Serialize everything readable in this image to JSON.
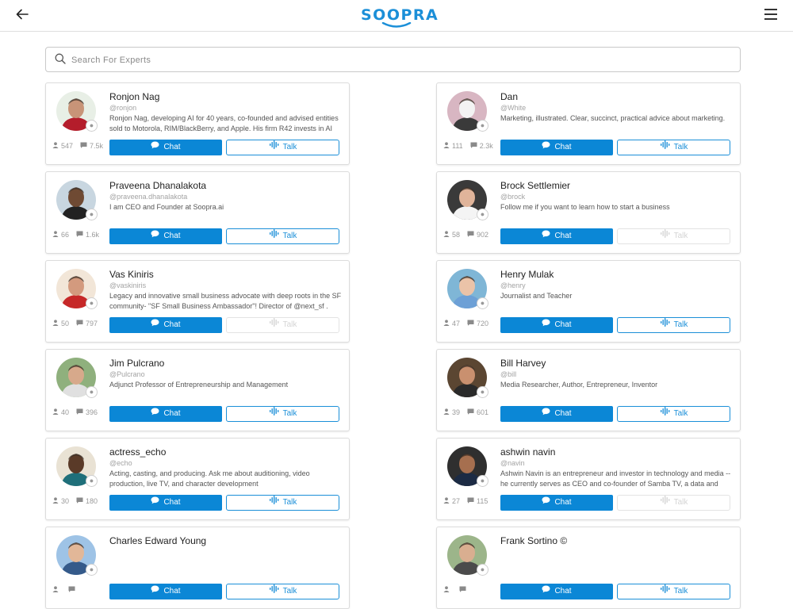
{
  "header": {
    "logo": "SOOPRA",
    "back_icon": "arrow-left-icon",
    "menu_icon": "hamburger-menu-icon"
  },
  "search": {
    "placeholder": "Search For Experts",
    "value": ""
  },
  "colors": {
    "accent": "#0b87d6",
    "outline": "#1b8fd8",
    "disabled": "#d4d4d4"
  },
  "buttons": {
    "chat": "Chat",
    "talk": "Talk"
  },
  "experts": [
    {
      "name": "Ronjon Nag",
      "handle": "@ronjon",
      "bio": "Ronjon Nag, developing AI for 40 years, co-founded and advised entities sold to Motorola, RIM/BlackBerry, and Apple. His firm R42 invests in AI and lo...",
      "followers": "547",
      "messages": "7.5k",
      "talk_enabled": true
    },
    {
      "name": "Dan",
      "handle": "@White",
      "bio": "Marketing, illustrated. Clear, succinct, practical advice about marketing.",
      "followers": "111",
      "messages": "2.3k",
      "talk_enabled": true
    },
    {
      "name": "Praveena Dhanalakota",
      "handle": "@praveena.dhanalakota",
      "bio": "I am CEO and Founder at Soopra.ai",
      "followers": "66",
      "messages": "1.6k",
      "talk_enabled": true
    },
    {
      "name": "Brock Settlemier",
      "handle": "@brock",
      "bio": "Follow me if you want to learn how to start a business",
      "followers": "58",
      "messages": "902",
      "talk_enabled": false
    },
    {
      "name": "Vas Kiniris",
      "handle": "@vaskiniris",
      "bio": "Legacy and innovative small business advocate with deep roots in the SF community- \"SF Small Business Ambassador\"! Director of @next_sf .",
      "followers": "50",
      "messages": "797",
      "talk_enabled": false
    },
    {
      "name": "Henry Mulak",
      "handle": "@henry",
      "bio": "Journalist and Teacher",
      "followers": "47",
      "messages": "720",
      "talk_enabled": true
    },
    {
      "name": "Jim Pulcrano",
      "handle": "@Pulcrano",
      "bio": "Adjunct Professor of Entrepreneurship and Management",
      "followers": "40",
      "messages": "396",
      "talk_enabled": true
    },
    {
      "name": "Bill Harvey",
      "handle": "@bill",
      "bio": "Media Researcher, Author, Entrepreneur, Inventor",
      "followers": "39",
      "messages": "601",
      "talk_enabled": true
    },
    {
      "name": "actress_echo",
      "handle": "@echo",
      "bio": "Acting, casting, and producing. Ask me about auditioning, video production, live TV, and character development",
      "followers": "30",
      "messages": "180",
      "talk_enabled": true
    },
    {
      "name": "ashwin navin",
      "handle": "@navin",
      "bio": "Ashwin Navin is an entrepreneur and investor in technology and media -- he currently serves as CEO and co-founder of Samba TV, a data and analytics...",
      "followers": "27",
      "messages": "115",
      "talk_enabled": false
    },
    {
      "name": "Charles Edward Young",
      "handle": "",
      "bio": "",
      "followers": "",
      "messages": "",
      "talk_enabled": true
    },
    {
      "name": "Frank Sortino ©",
      "handle": "",
      "bio": "",
      "followers": "",
      "messages": "",
      "talk_enabled": true
    }
  ]
}
